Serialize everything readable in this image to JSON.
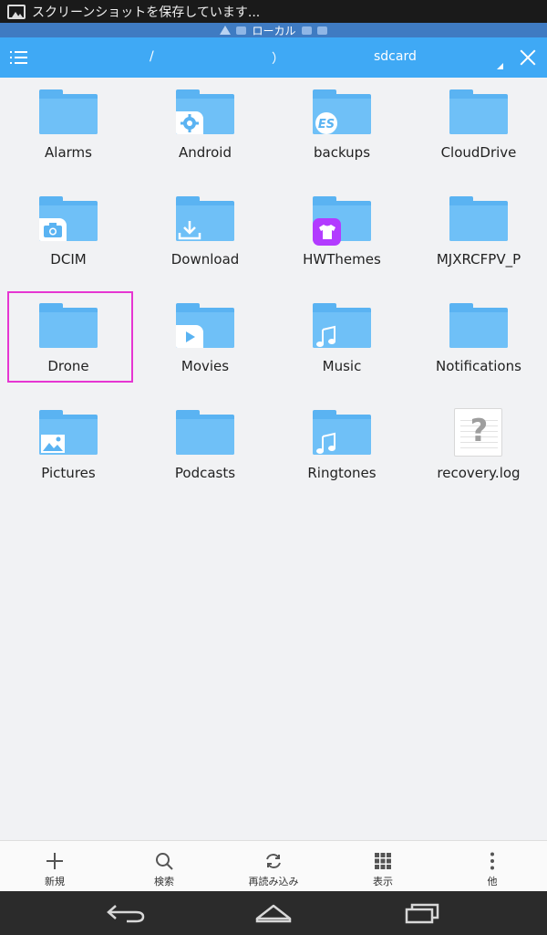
{
  "status_bar": {
    "text": "スクリーンショットを保存しています..."
  },
  "crumb_bar": {
    "text": "ローカル"
  },
  "toolbar": {
    "separator": "/",
    "paren": "）",
    "current_folder": "sdcard"
  },
  "files": [
    {
      "label": "Alarms",
      "type": "folder",
      "badge": ""
    },
    {
      "label": "Android",
      "type": "folder",
      "badge": "settings-gear"
    },
    {
      "label": "backups",
      "type": "folder",
      "badge": "es-logo"
    },
    {
      "label": "CloudDrive",
      "type": "folder",
      "badge": ""
    },
    {
      "label": "DCIM",
      "type": "folder",
      "badge": "camera"
    },
    {
      "label": "Download",
      "type": "folder",
      "badge": "download-arrow"
    },
    {
      "label": "HWThemes",
      "type": "folder",
      "badge": "theme-shirt"
    },
    {
      "label": "MJXRCFPV_P",
      "type": "folder",
      "badge": ""
    },
    {
      "label": "Drone",
      "type": "folder",
      "badge": "",
      "selected": true
    },
    {
      "label": "Movies",
      "type": "folder",
      "badge": "play"
    },
    {
      "label": "Music",
      "type": "folder",
      "badge": "music-note"
    },
    {
      "label": "Notifications",
      "type": "folder",
      "badge": ""
    },
    {
      "label": "Pictures",
      "type": "folder",
      "badge": "picture"
    },
    {
      "label": "Podcasts",
      "type": "folder",
      "badge": ""
    },
    {
      "label": "Ringtones",
      "type": "folder",
      "badge": "music-note"
    },
    {
      "label": "recovery.log",
      "type": "file",
      "badge": "unknown-file"
    }
  ],
  "bottom_bar": {
    "new": "新規",
    "search": "検索",
    "reload": "再読み込み",
    "view": "表示",
    "more": "他"
  },
  "colors": {
    "toolbar": "#3fa9f5",
    "folder": "#6fc0f7",
    "selection": "#e636d2",
    "background": "#f1f2f4"
  }
}
